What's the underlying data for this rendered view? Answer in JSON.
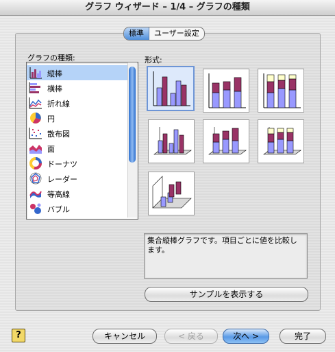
{
  "window": {
    "title": "グラフ ウィザード – 1/4 – グラフの種類"
  },
  "tabs": [
    {
      "label": "標準"
    },
    {
      "label": "ユーザー設定"
    }
  ],
  "chart_types": {
    "label": "グラフの種類:",
    "items": [
      {
        "label": "縦棒",
        "icon": "column-chart-icon"
      },
      {
        "label": "横棒",
        "icon": "bar-chart-icon"
      },
      {
        "label": "折れ線",
        "icon": "line-chart-icon"
      },
      {
        "label": "円",
        "icon": "pie-chart-icon"
      },
      {
        "label": "散布図",
        "icon": "scatter-chart-icon"
      },
      {
        "label": "面",
        "icon": "area-chart-icon"
      },
      {
        "label": "ドーナツ",
        "icon": "doughnut-chart-icon"
      },
      {
        "label": "レーダー",
        "icon": "radar-chart-icon"
      },
      {
        "label": "等高線",
        "icon": "surface-chart-icon"
      },
      {
        "label": "バブル",
        "icon": "bubble-chart-icon"
      }
    ],
    "selected": "縦棒"
  },
  "subtypes": {
    "label": "形式:",
    "selected_index": 0,
    "items": [
      {
        "name": "clustered-column-icon"
      },
      {
        "name": "stacked-column-icon"
      },
      {
        "name": "100-stacked-column-icon"
      },
      {
        "name": "3d-clustered-column-icon"
      },
      {
        "name": "3d-stacked-column-icon"
      },
      {
        "name": "3d-100-stacked-column-icon"
      },
      {
        "name": "3d-column-icon"
      }
    ]
  },
  "description": "集合縦棒グラフです。項目ごとに値を比較します。",
  "preview_button": "サンプルを表示する",
  "buttons": {
    "cancel": "キャンセル",
    "back": "< 戻る",
    "next": "次へ >",
    "finish": "完了"
  },
  "help_icon": "?",
  "colors": {
    "accent": "#4e8fdc",
    "series1": "#9999ff",
    "series2": "#993366",
    "series3": "#ffffcc"
  }
}
